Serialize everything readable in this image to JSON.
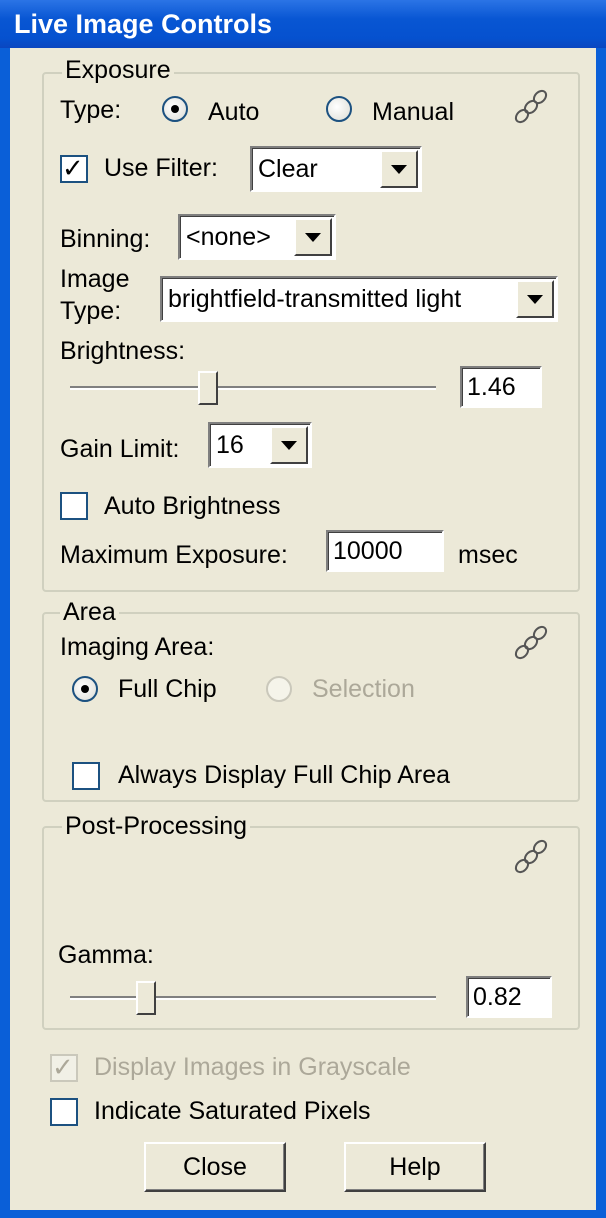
{
  "window": {
    "title": "Live Image Controls"
  },
  "exposure": {
    "group_title": "Exposure",
    "type_label": "Type:",
    "type_options": [
      "Auto",
      "Manual"
    ],
    "type_selected": "Auto",
    "use_filter_label": "Use Filter:",
    "use_filter_checked": true,
    "filter_value": "Clear",
    "binning_label": "Binning:",
    "binning_value": "<none>",
    "image_type_label_line1": "Image",
    "image_type_label_line2": "Type:",
    "image_type_value": "brightfield-transmitted light",
    "brightness_label": "Brightness:",
    "brightness_value": "1.46",
    "gain_limit_label": "Gain Limit:",
    "gain_limit_value": "16",
    "auto_brightness_label": "Auto Brightness",
    "auto_brightness_checked": false,
    "max_exposure_label": "Maximum Exposure:",
    "max_exposure_value": "10000",
    "max_exposure_unit": "msec"
  },
  "area": {
    "group_title": "Area",
    "imaging_area_label": "Imaging Area:",
    "options": [
      "Full Chip",
      "Selection"
    ],
    "selected": "Full Chip",
    "always_display_label": "Always Display Full Chip Area",
    "always_display_checked": false
  },
  "post_processing": {
    "group_title": "Post-Processing",
    "gamma_label": "Gamma:",
    "gamma_value": "0.82"
  },
  "options": {
    "grayscale_label": "Display Images in Grayscale",
    "grayscale_checked": true,
    "grayscale_enabled": false,
    "saturated_label": "Indicate Saturated Pixels",
    "saturated_checked": false
  },
  "buttons": {
    "close": "Close",
    "help": "Help"
  },
  "colors": {
    "titlebar": "#0a5fd8",
    "dialog_bg": "#ece9d8",
    "disabled_text": "#aca899"
  }
}
